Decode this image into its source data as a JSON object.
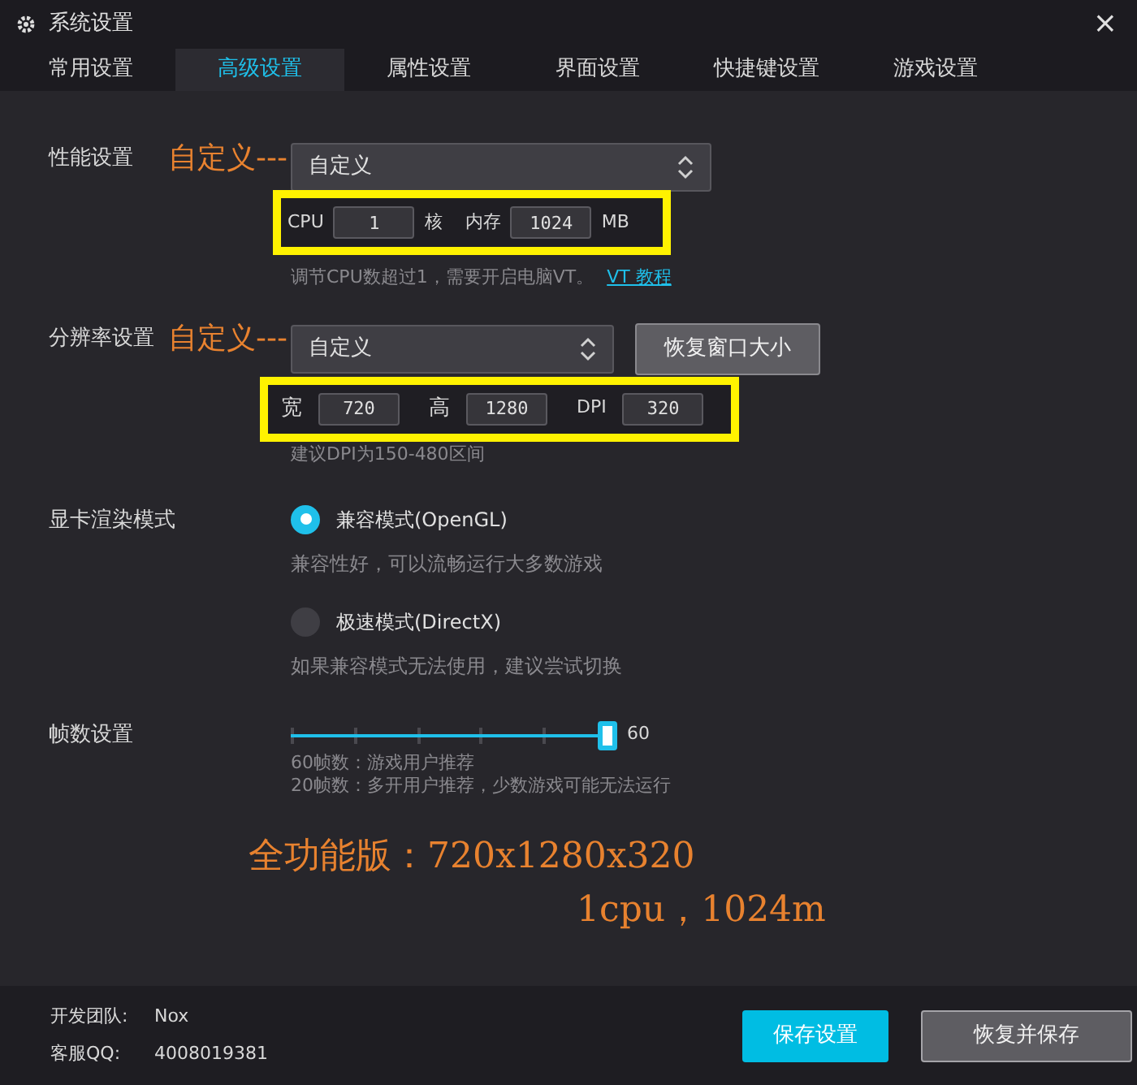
{
  "window": {
    "title": "系统设置",
    "close": "×"
  },
  "tabs": [
    {
      "label": "常用设置",
      "selected": false
    },
    {
      "label": "高级设置",
      "selected": true
    },
    {
      "label": "属性设置",
      "selected": false
    },
    {
      "label": "界面设置",
      "selected": false
    },
    {
      "label": "快捷键设置",
      "selected": false
    },
    {
      "label": "游戏设置",
      "selected": false
    }
  ],
  "performance": {
    "label": "性能设置",
    "annotation": "自定义---",
    "select": "自定义",
    "fields": [
      {
        "label": "CPU",
        "value": "1",
        "unit": "核"
      },
      {
        "label": "内存",
        "value": "1024",
        "unit": "MB"
      }
    ],
    "hint": "调节CPU数超过1，需要开启电脑VT。",
    "link": "VT 教程"
  },
  "resolution": {
    "label": "分辨率设置",
    "annotation": "自定义---",
    "select": "自定义",
    "button": "恢复窗口大小",
    "fields": [
      {
        "label": "宽",
        "value": "720"
      },
      {
        "label": "高",
        "value": "1280"
      },
      {
        "label": "DPI",
        "value": "320"
      }
    ],
    "hint": "建议DPI为150-480区间"
  },
  "render": {
    "label": "显卡渲染模式",
    "options": [
      {
        "label": "兼容模式(OpenGL)",
        "description": "兼容性好，可以流畅运行大多数游戏",
        "selected": true
      },
      {
        "label": "极速模式(DirectX)",
        "description": "如果兼容模式无法使用，建议尝试切换",
        "selected": false
      }
    ]
  },
  "fps": {
    "label": "帧数设置",
    "level": 1,
    "value": "60",
    "hints": [
      "60帧数：游戏用户推荐",
      "20帧数：多开用户推荐，少数游戏可能无法运行"
    ]
  },
  "note": [
    "全功能版：720x1280x320",
    "1cpu，1024m"
  ],
  "footer": {
    "info": [
      {
        "label": "开发团队:",
        "value": "Nox"
      },
      {
        "label": "客服QQ:",
        "value": "4008019381"
      }
    ],
    "buttons": [
      {
        "label": "保存设置",
        "kind": "primary"
      },
      {
        "label": "恢复并保存",
        "kind": "secondary"
      }
    ]
  }
}
